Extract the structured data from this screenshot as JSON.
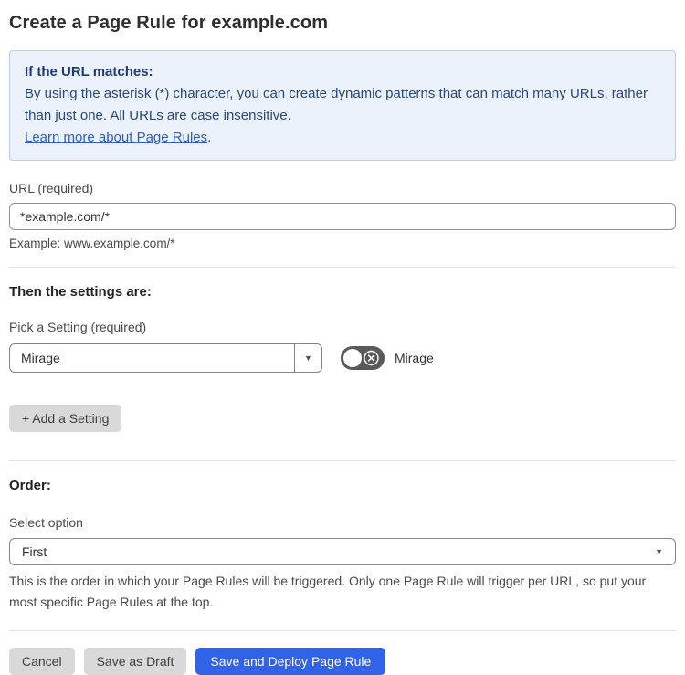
{
  "page": {
    "title": "Create a Page Rule for example.com"
  },
  "info_box": {
    "heading": "If the URL matches:",
    "body": "By using the asterisk (*) character, you can create dynamic patterns that can match many URLs, rather than just one. All URLs are case insensitive.",
    "link_text": "Learn more about Page Rules",
    "link_suffix": "."
  },
  "url_field": {
    "label": "URL (required)",
    "value": "*example.com/*",
    "helper": "Example: www.example.com/*"
  },
  "settings_section": {
    "heading": "Then the settings are:",
    "picker_label": "Pick a Setting (required)",
    "selected_setting": "Mirage",
    "dropdown_arrow": "▼",
    "toggle_state": "off",
    "toggle_label": "Mirage",
    "add_button_label": "+ Add a Setting"
  },
  "order_section": {
    "heading": "Order:",
    "select_label": "Select option",
    "selected_option": "First",
    "dropdown_arrow": "▼",
    "helper": "This is the order in which your Page Rules will be triggered. Only one Page Rule will trigger per URL, so put your most specific Page Rules at the top."
  },
  "footer": {
    "cancel_label": "Cancel",
    "save_draft_label": "Save as Draft",
    "save_deploy_label": "Save and Deploy Page Rule"
  },
  "colors": {
    "info_box_bg": "#ebf2fc",
    "info_box_border": "#b8cff2",
    "info_box_text": "#2a4680",
    "link": "#2d5dc8",
    "primary_button": "#3163e8",
    "gray_button": "#d9d9d9",
    "toggle_off_bg": "#595959",
    "input_border": "#858585"
  }
}
